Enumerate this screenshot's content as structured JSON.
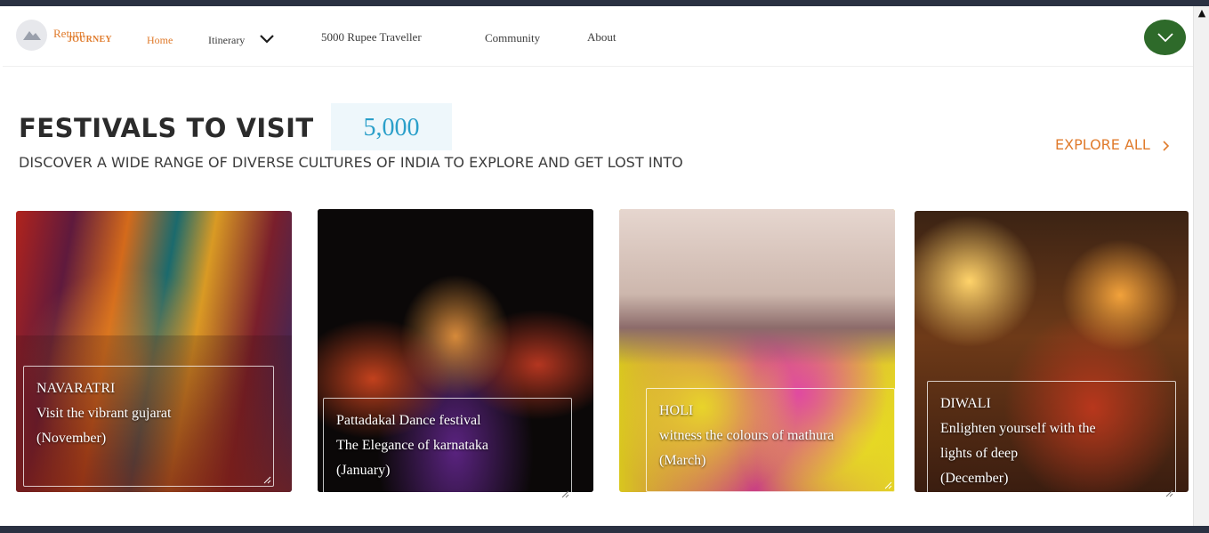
{
  "nav": {
    "logo_top": "Return",
    "logo_bottom": "JOURNEY",
    "home": "Home",
    "itinerary": "Itinerary",
    "five_thousand": "5000 Rupee Traveller",
    "community": "Community",
    "about": "About"
  },
  "section": {
    "title": "FESTIVALS TO VISIT",
    "counter": "5,000",
    "subtitle": "DISCOVER A WIDE RANGE OF DIVERSE CULTURES OF INDIA TO EXPLORE AND GET LOST INTO",
    "explore_all": "EXPLORE ALL"
  },
  "cards": [
    {
      "name": "NAVARATRI",
      "tagline": "Visit the vibrant gujarat",
      "month": "(November)"
    },
    {
      "name": "Pattadakal Dance festival",
      "tagline": "The Elegance of karnataka",
      "month": "(January)"
    },
    {
      "name": "HOLI",
      "tagline": "witness the colours of mathura",
      "month": "(March)"
    },
    {
      "name": "DIWALI",
      "tagline": "Enlighten yourself with the",
      "tagline2": "lights of  deep",
      "month": "(December)"
    }
  ],
  "colors": {
    "accent": "#e07b2c",
    "counter": "#2a9fc9",
    "menu_button": "#2e6a2a",
    "frame": "#2a3142"
  },
  "icons": [
    "mountain-logo-icon",
    "chevron-down-icon",
    "menu-chevron-icon",
    "chevron-right-icon",
    "resize-handle-icon"
  ]
}
